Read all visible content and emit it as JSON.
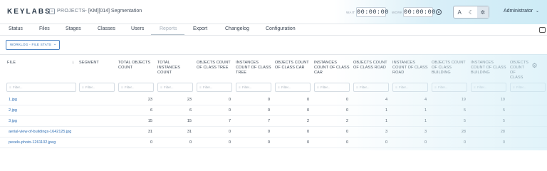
{
  "app": {
    "logo": "KEYLABS",
    "projects_label": "PROJECTS",
    "breadcrumb_arrow": "→",
    "project_name": "[KM][014] Segmentation"
  },
  "timers": {
    "wait_label": "WAIT",
    "wait_value": "00:00:00",
    "work_label": "WORK",
    "work_value": "00:00:00"
  },
  "modes": [
    {
      "icon": "text-a-icon",
      "glyph": "A"
    },
    {
      "icon": "moon-icon",
      "glyph": "☾"
    },
    {
      "icon": "sun-icon",
      "glyph": "✲"
    }
  ],
  "user": {
    "name": "Administrator",
    "caret": "⌄"
  },
  "tabs": [
    {
      "label": "Status"
    },
    {
      "label": "Files"
    },
    {
      "label": "Stages"
    },
    {
      "label": "Classes"
    },
    {
      "label": "Users"
    },
    {
      "label": "Reports"
    },
    {
      "label": "Export"
    },
    {
      "label": "Changelog"
    },
    {
      "label": "Configuration"
    }
  ],
  "active_tab": "Reports",
  "workflow": {
    "label": "WORKLOG - FILE STATS",
    "caret": "⌄"
  },
  "table": {
    "columns": [
      "FILE",
      "SEGMENT",
      "TOTAL OBJECTS COUNT",
      "TOTAL INSTANCES COUNT",
      "OBJECTS COUNT OF CLASS TREE",
      "INSTANCES COUNT OF CLASS TREE",
      "OBJECTS COUNT OF CLASS CAR",
      "INSTANCES COUNT OF CLASS CAR",
      "OBJECTS COUNT OF CLASS ROAD",
      "INSTANCES COUNT OF CLASS ROAD",
      "OBJECTS COUNT OF CLASS BUILDING",
      "INSTANCES COUNT OF CLASS BUILDING",
      "OBJECTS COUNT OF CLASS"
    ],
    "sort_icon": "↓",
    "filter_placeholder": "Filter...",
    "filter_icon": "≡",
    "rows": [
      {
        "file": "1.jpg",
        "segment": "",
        "values": [
          "23",
          "23",
          "0",
          "0",
          "0",
          "0",
          "4",
          "4",
          "19",
          "19"
        ]
      },
      {
        "file": "2.jpg",
        "segment": "",
        "values": [
          "6",
          "6",
          "0",
          "0",
          "0",
          "0",
          "1",
          "1",
          "5",
          "5"
        ]
      },
      {
        "file": "3.jpg",
        "segment": "",
        "values": [
          "15",
          "15",
          "7",
          "7",
          "2",
          "2",
          "1",
          "1",
          "5",
          "5"
        ]
      },
      {
        "file": "aerial-view-of-buildings-1642125.jpg",
        "segment": "",
        "values": [
          "31",
          "31",
          "0",
          "0",
          "0",
          "0",
          "3",
          "3",
          "28",
          "28"
        ]
      },
      {
        "file": "pexels-photo-1261102.jpeg",
        "segment": "",
        "values": [
          "0",
          "0",
          "0",
          "0",
          "0",
          "0",
          "0",
          "0",
          "0",
          "0"
        ]
      }
    ]
  }
}
